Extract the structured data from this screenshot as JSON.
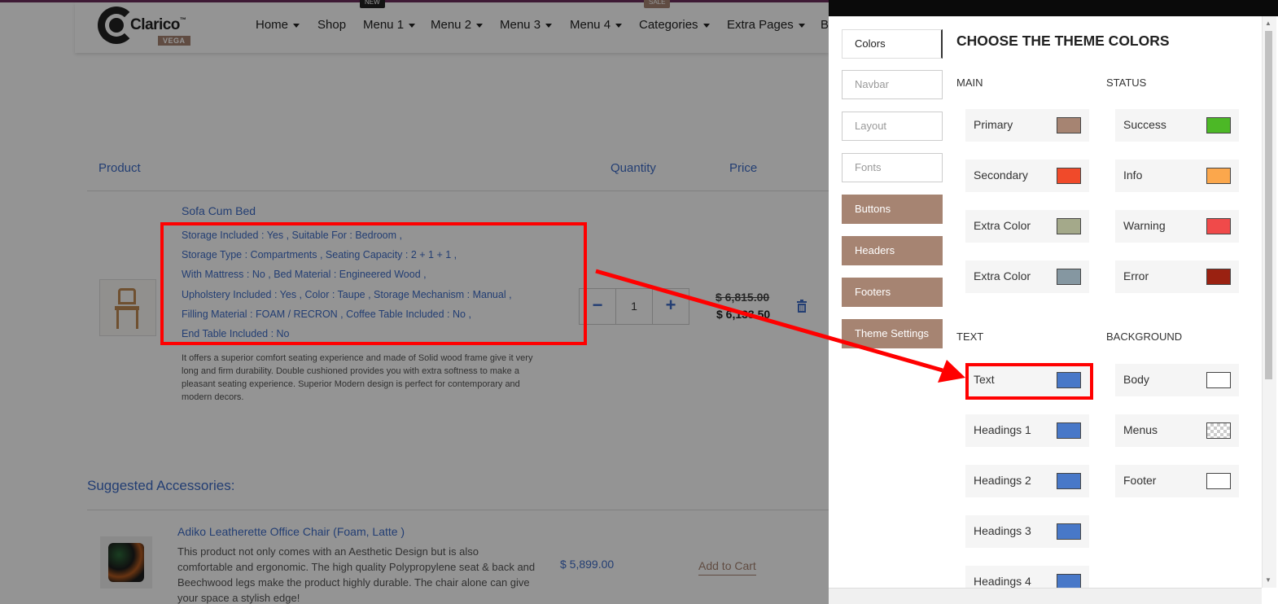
{
  "navbar": {
    "logo_text": "Clarico",
    "logo_tm": "™",
    "logo_badge": "VEGA",
    "items": [
      {
        "label": "Home",
        "caret": true
      },
      {
        "label": "Shop",
        "caret": false
      },
      {
        "label": "Menu 1",
        "caret": true,
        "badge": "NEW"
      },
      {
        "label": "Menu 2",
        "caret": true
      },
      {
        "label": "Menu 3",
        "caret": true
      },
      {
        "label": "Menu 4",
        "caret": true
      },
      {
        "label": "Categories",
        "caret": true,
        "badge": "SALE"
      },
      {
        "label": "Extra Pages",
        "caret": true
      },
      {
        "label": "B",
        "caret": false
      }
    ]
  },
  "cart": {
    "headers": {
      "product": "Product",
      "quantity": "Quantity",
      "price": "Price"
    },
    "item": {
      "name": "Sofa Cum Bed",
      "attributes": [
        "Storage Included : Yes , Suitable For : Bedroom ,",
        "Storage Type : Compartments , Seating Capacity : 2 + 1 + 1 ,",
        "With Mattress : No , Bed Material : Engineered Wood ,",
        "Upholstery Included : Yes , Color : Taupe , Storage Mechanism : Manual ,",
        "Filling Material : FOAM / RECRON , Coffee Table Included : No ,",
        "End Table Included : No"
      ],
      "description": "It offers a superior comfort seating experience and made of Solid wood frame give it very long and firm durability. Double cushioned provides you with extra softness to make a pleasant seating experience. Superior Modern design is perfect for contemporary and modern decors.",
      "qty_minus": "−",
      "quantity": "1",
      "qty_plus": "+",
      "price_old": "$ 6,815.00",
      "price_new": "$ 6,133.50"
    }
  },
  "suggested": {
    "title": "Suggested Accessories:",
    "item": {
      "name": "Adiko Leatherette Office Chair (Foam, Latte )",
      "description": "This product not only comes with an Aesthetic Design but is also comfortable and ergonomic. The high quality Polypropylene seat & back and Beechwood legs make the product highly durable. The chair alone can give your space a stylish edge!",
      "price": "$ 5,899.00",
      "button": "Add to Cart"
    }
  },
  "theme_panel": {
    "title": "CHOOSE THE THEME COLORS",
    "tabs": [
      {
        "label": "Colors",
        "style": "active"
      },
      {
        "label": "Navbar",
        "style": "plain"
      },
      {
        "label": "Layout",
        "style": "plain"
      },
      {
        "label": "Fonts",
        "style": "plain"
      },
      {
        "label": "Buttons",
        "style": "brown"
      },
      {
        "label": "Headers",
        "style": "brown"
      },
      {
        "label": "Footers",
        "style": "brown"
      },
      {
        "label": "Theme Settings",
        "style": "brown"
      }
    ],
    "sections": {
      "main": "MAIN",
      "status": "STATUS",
      "text": "TEXT",
      "background": "BACKGROUND"
    },
    "main_colors": [
      {
        "label": "Primary",
        "color": "#a68472"
      },
      {
        "label": "Secondary",
        "color": "#f04a2a"
      },
      {
        "label": "Extra Color",
        "color": "#a4a98a"
      },
      {
        "label": "Extra Color",
        "color": "#8597a1"
      }
    ],
    "status_colors": [
      {
        "label": "Success",
        "color": "#4cb826"
      },
      {
        "label": "Info",
        "color": "#fba74c"
      },
      {
        "label": "Warning",
        "color": "#f04a4a"
      },
      {
        "label": "Error",
        "color": "#9a2111"
      }
    ],
    "text_colors": [
      {
        "label": "Text",
        "color": "#4878c8"
      },
      {
        "label": "Headings 1",
        "color": "#4878c8"
      },
      {
        "label": "Headings 2",
        "color": "#4878c8"
      },
      {
        "label": "Headings 3",
        "color": "#4878c8"
      },
      {
        "label": "Headings 4",
        "color": "#4878c8"
      }
    ],
    "background_colors": [
      {
        "label": "Body",
        "color": "#ffffff"
      },
      {
        "label": "Menus",
        "color": "transparent"
      },
      {
        "label": "Footer",
        "color": "#ffffff"
      }
    ]
  },
  "colors": {
    "link_blue": "#3d6cc7",
    "brand_brown": "#a68472",
    "annotation_red": "#ff0000",
    "overlay": "rgba(0,0,0,0.42)"
  }
}
